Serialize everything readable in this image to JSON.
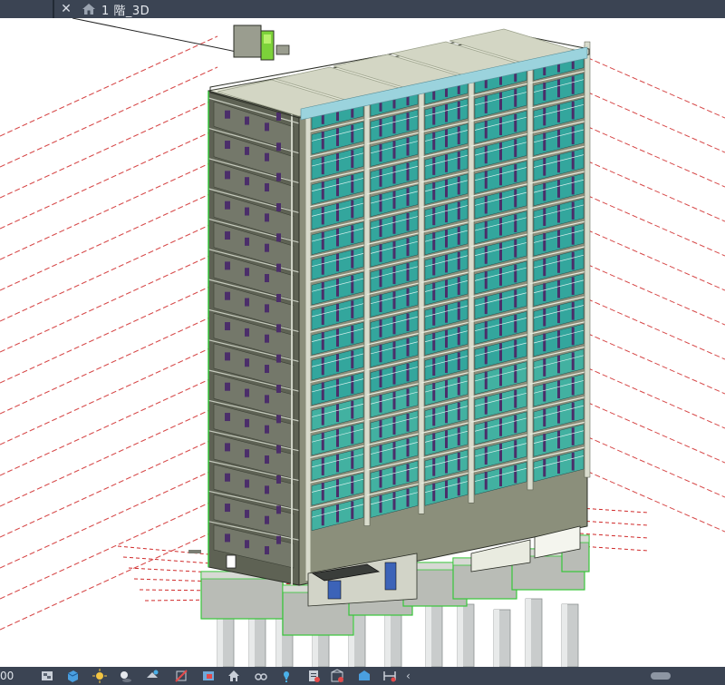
{
  "tabs": {
    "active_label": "1 階_3D"
  },
  "statusbar": {
    "scale_text": "00",
    "scroll_left_glyph": "‹"
  },
  "icons": {
    "home": "home-icon",
    "close": "close-icon"
  },
  "colors": {
    "ui_bar": "#3b4453",
    "glass": "#2fa89f",
    "mullion": "#4b2e6a",
    "structure_edge": "#37c63a",
    "grid_line": "#d02a2a"
  }
}
